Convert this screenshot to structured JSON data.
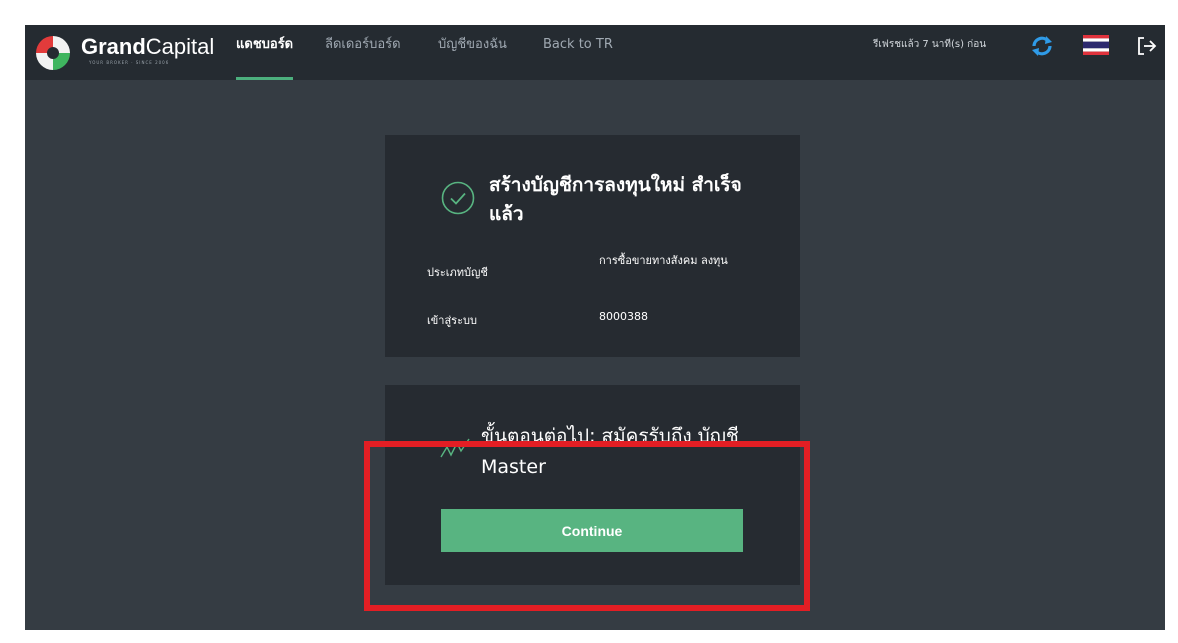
{
  "brand": {
    "name_bold": "Grand",
    "name_light": "Capital",
    "tagline": "YOUR BROKER · SINCE 2006"
  },
  "nav": {
    "items": [
      {
        "label": "แดชบอร์ด",
        "active": true
      },
      {
        "label": "ลีดเดอร์บอร์ด",
        "active": false
      },
      {
        "label": "บัญชีของฉัน",
        "active": false
      },
      {
        "label": "Back to TR",
        "active": false
      }
    ]
  },
  "header": {
    "refresh_status": "รีเฟรชแล้ว 7 นาที(s) ก่อน",
    "icons": [
      "refresh-icon",
      "thai-flag-icon",
      "logout-icon"
    ]
  },
  "success_card": {
    "title": "สร้างบัญชีการลงทุนใหม่ สำเร็จแล้ว",
    "rows": [
      {
        "label": "ประเภทบัญชี",
        "value": "การซื้อขายทางสังคม ลงทุน"
      },
      {
        "label": "เข้าสู่ระบบ",
        "value": "8000388"
      }
    ]
  },
  "next_card": {
    "title": "ขั้นตอนต่อไป: สมัครรับถึง บัญชี Master",
    "button_label": "Continue"
  },
  "colors": {
    "accent_green": "#58b481",
    "highlight_red": "#e31e24",
    "header_bg": "#252b31",
    "page_bg": "#353c43",
    "card_bg": "#262b31"
  }
}
